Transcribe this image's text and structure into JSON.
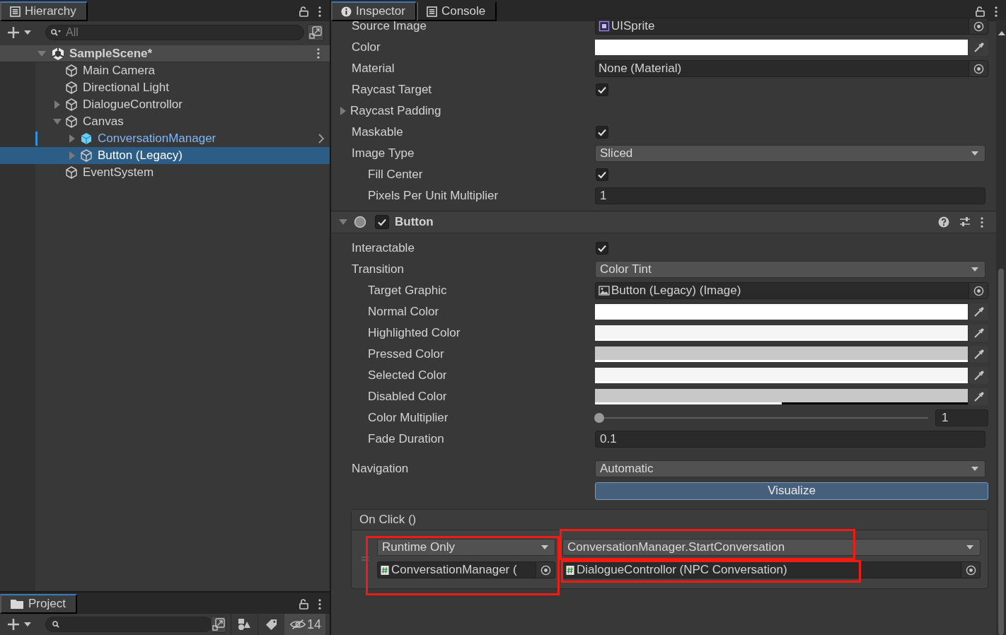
{
  "hierarchy": {
    "tab": {
      "label": "Hierarchy",
      "selected": true
    },
    "search": {
      "placeholder": "All"
    },
    "scene": {
      "label": "SampleScene*",
      "expanded": true
    },
    "items": [
      {
        "label": "Main Camera",
        "kind": "object",
        "selected": false,
        "modified": false
      },
      {
        "label": "Directional Light",
        "kind": "object",
        "selected": false,
        "modified": false
      },
      {
        "label": "DialogueControllor",
        "kind": "object",
        "expanded": false,
        "selected": false,
        "modified": false
      },
      {
        "label": "Canvas",
        "kind": "object",
        "expanded": true,
        "selected": false,
        "modified": false,
        "children": [
          {
            "label": "ConversationManager",
            "kind": "prefab",
            "expanded": false,
            "selected": false,
            "modified": true
          },
          {
            "label": "Button (Legacy)",
            "kind": "object",
            "expanded": false,
            "selected": true,
            "modified": false
          }
        ]
      },
      {
        "label": "EventSystem",
        "kind": "object",
        "selected": false,
        "modified": false
      }
    ]
  },
  "project": {
    "tab": {
      "label": "Project",
      "selected": true
    },
    "hidden_count": "14"
  },
  "inspector": {
    "tabs": [
      {
        "label": "Inspector",
        "kind": "info",
        "selected": true
      },
      {
        "label": "Console",
        "kind": "console",
        "selected": false
      }
    ],
    "image_properties": [
      {
        "kind": "sprite_object",
        "label": "Source Image",
        "value": "UISprite"
      },
      {
        "kind": "color",
        "label": "Color",
        "color": "#ffffff",
        "level": 1
      },
      {
        "kind": "object",
        "label": "Material",
        "value": "None (Material)"
      },
      {
        "kind": "checkbox",
        "label": "Raycast Target",
        "checked": true
      },
      {
        "kind": "foldout",
        "label": "Raycast Padding",
        "expanded": false
      },
      {
        "kind": "checkbox",
        "label": "Maskable",
        "checked": true
      },
      {
        "kind": "dropdown",
        "label": "Image Type",
        "value": "Sliced",
        "children": [
          {
            "kind": "checkbox",
            "label": "Fill Center",
            "checked": true
          },
          {
            "kind": "number",
            "label": "Pixels Per Unit Multiplier",
            "value": "1"
          }
        ]
      }
    ],
    "component": {
      "title": "Button",
      "expanded": true,
      "enabled": true
    },
    "button_properties": [
      {
        "kind": "checkbox",
        "label": "Interactable",
        "checked": true
      },
      {
        "kind": "dropdown",
        "label": "Transition",
        "value": "Color Tint",
        "children": [
          {
            "kind": "image_object",
            "label": "Target Graphic",
            "value": "Button (Legacy) (Image)"
          },
          {
            "kind": "color",
            "label": "Normal Color",
            "color": "#ffffff",
            "level": 1
          },
          {
            "kind": "color",
            "label": "Highlighted Color",
            "color": "#f5f5f5",
            "level": 1
          },
          {
            "kind": "color",
            "label": "Pressed Color",
            "color": "#c8c8c8",
            "level": 1
          },
          {
            "kind": "color",
            "label": "Selected Color",
            "color": "#f5f5f5",
            "level": 1
          },
          {
            "kind": "color",
            "label": "Disabled Color",
            "color": "#c8c8c8",
            "level": 0.5
          },
          {
            "kind": "slider",
            "label": "Color Multiplier",
            "level": 0,
            "value": "1"
          },
          {
            "kind": "number",
            "label": "Fade Duration",
            "value": "0.1"
          }
        ]
      },
      {
        "kind": "dropdown",
        "label": "Navigation",
        "value": "Automatic"
      },
      {
        "kind": "button",
        "label": "Visualize"
      }
    ],
    "on_click": {
      "title": "On Click ()",
      "listeners": [
        {
          "call_state": "Runtime Only",
          "object": "ConversationManager (",
          "function": "ConversationManager.StartConversation",
          "argument": "DialogueControllor (NPC Conversation)",
          "highlight_object_column": true,
          "highlight_function": true,
          "highlight_argument": true
        }
      ]
    }
  }
}
